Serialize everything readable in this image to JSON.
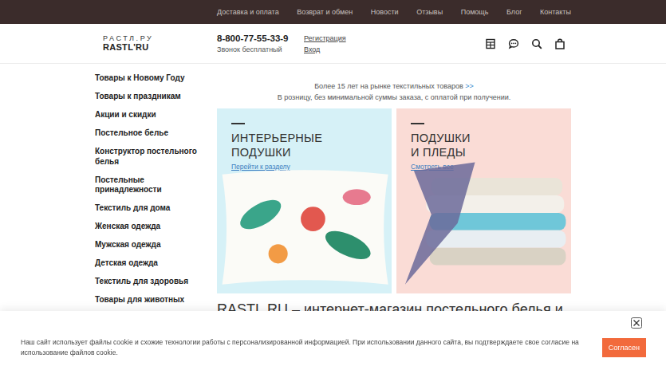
{
  "top_nav": [
    "Доставка и оплата",
    "Возврат и обмен",
    "Новости",
    "Отзывы",
    "Помощь",
    "Блог",
    "Контакты"
  ],
  "header": {
    "logo_top": "РАСТЛ.РУ",
    "logo_bottom": "RASTL'RU",
    "phone": "8-800-77-55-33-9",
    "phone_note": "Звонок бесплатный",
    "auth_links": [
      "Регистрация",
      "Вход"
    ]
  },
  "sidebar": {
    "items": [
      "Товары к Новому Году",
      "Товары к праздникам",
      "Акции и скидки",
      "Постельное белье",
      "Конструктор постельного белья",
      "Постельные принадлежности",
      "Текстиль для дома",
      "Женская одежда",
      "Мужская одежда",
      "Детская одежда",
      "Текстиль для здоровья",
      "Товары для животных"
    ]
  },
  "intro": {
    "line1": "Более 15 лет на рынке текстильных товаров",
    "more": ">>",
    "line2": "В розницу, без минимальной суммы заказа, с оплатой при получении."
  },
  "banners": [
    {
      "title_lines": [
        "ИНТЕРЬЕРНЫЕ ПОДУШКИ"
      ],
      "link": "Перейти к разделу",
      "color": "#d6f1f7"
    },
    {
      "title_lines": [
        "ПОДУШКИ",
        "И ПЛЕДЫ"
      ],
      "link": "Смотреть все",
      "color": "#fadcd6"
    }
  ],
  "heading": "RASTL.RU – интернет-магазин постельного белья и",
  "cookie": {
    "text": "Наш сайт использует файлы cookie и схожие технологии работы с персонализированной информацией. При использовании данного сайта, вы подтверждаете свое согласие на использование файлов cookie.",
    "button": "Согласен"
  }
}
